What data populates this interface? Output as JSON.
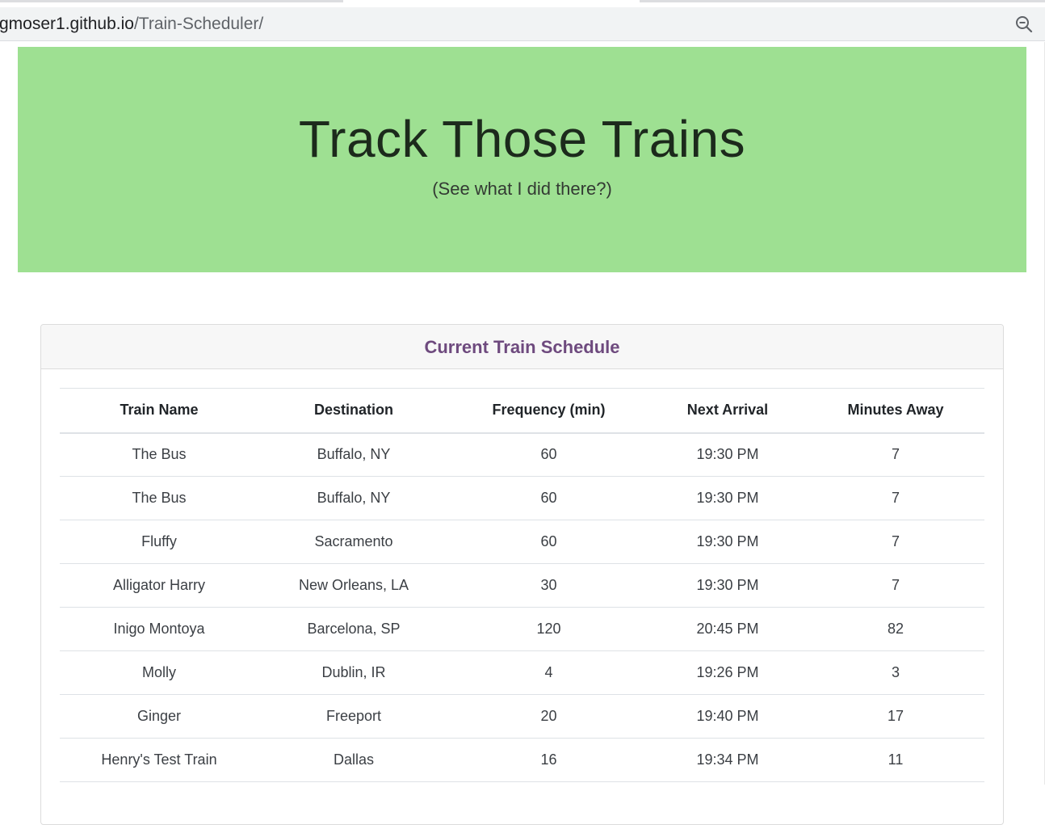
{
  "browser": {
    "url_host": "gmoser1.github.io",
    "url_path": "/Train-Scheduler/",
    "zoom_icon": "zoom-out-icon"
  },
  "jumbotron": {
    "title": "Track Those Trains",
    "subtitle": "(See what I did there?)",
    "background": "#9ee092"
  },
  "schedule": {
    "heading": "Current Train Schedule",
    "heading_color": "#6e4a7e",
    "columns": [
      "Train Name",
      "Destination",
      "Frequency (min)",
      "Next Arrival",
      "Minutes Away"
    ],
    "rows": [
      [
        "The Bus",
        "Buffalo, NY",
        "60",
        "19:30 PM",
        "7"
      ],
      [
        "The Bus",
        "Buffalo, NY",
        "60",
        "19:30 PM",
        "7"
      ],
      [
        "Fluffy",
        "Sacramento",
        "60",
        "19:30 PM",
        "7"
      ],
      [
        "Alligator Harry",
        "New Orleans, LA",
        "30",
        "19:30 PM",
        "7"
      ],
      [
        "Inigo Montoya",
        "Barcelona, SP",
        "120",
        "20:45 PM",
        "82"
      ],
      [
        "Molly",
        "Dublin, IR",
        "4",
        "19:26 PM",
        "3"
      ],
      [
        "Ginger",
        "Freeport",
        "20",
        "19:40 PM",
        "17"
      ],
      [
        "Henry's Test Train",
        "Dallas",
        "16",
        "19:34 PM",
        "11"
      ]
    ]
  }
}
